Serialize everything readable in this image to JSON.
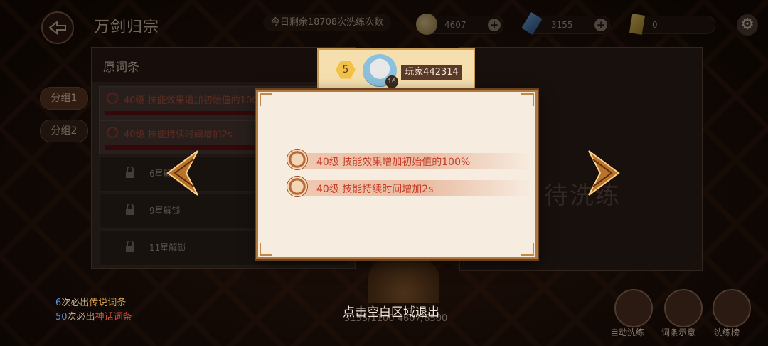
{
  "header": {
    "title": "万剑归宗",
    "remaining": "今日剩余18708次洗练次数",
    "coin_value": "4607",
    "crystal_value": "3155",
    "ticket_value": "0",
    "plus": "+"
  },
  "left_panel": {
    "title": "原词条",
    "entries": [
      {
        "text": "40级 技能效果增加初始值的100%"
      },
      {
        "text": "40级 技能持续时间增加2s"
      }
    ],
    "locked": [
      "6星解锁",
      "9星解锁",
      "11星解锁"
    ]
  },
  "groups": [
    "分组1",
    "分组2"
  ],
  "right_panel": {
    "placeholder": "待洗练"
  },
  "player": {
    "level": "5",
    "name": "玩家442314",
    "badge": "16"
  },
  "popup": {
    "rows": [
      {
        "text": "40级 技能效果增加初始值的100%"
      },
      {
        "text": "40级 技能持续时间增加2s"
      }
    ]
  },
  "hints": {
    "line1": {
      "count": "6",
      "mid": "次必出",
      "kind": "传说词条"
    },
    "line2": {
      "count": "50",
      "mid": "次必出",
      "kind": "神话词条"
    }
  },
  "cost": {
    "a": "3155",
    "b": "/1100",
    "c": "4607",
    "d": "/6500"
  },
  "exit_hint": "点击空白区域退出",
  "bottom_buttons": [
    "自动洗练",
    "词条示意",
    "洗练榜"
  ],
  "colors": {
    "accent_red": "#c63c28",
    "gold": "#c89a52",
    "legend": "#d4a24a",
    "myth": "#d64a3a"
  }
}
